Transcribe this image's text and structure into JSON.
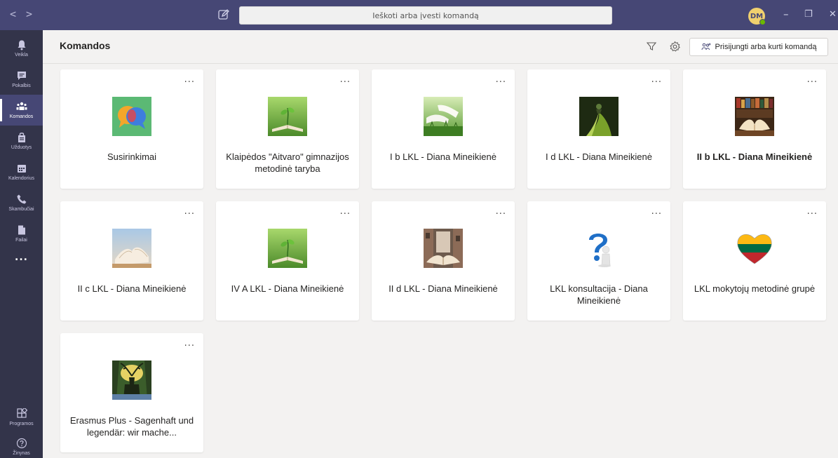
{
  "titlebar": {
    "back": "<",
    "forward": ">",
    "search_placeholder": "Ieškoti arba įvesti komandą",
    "avatar_initials": "DM",
    "minimize": "–",
    "maximize": "❐",
    "close": "✕"
  },
  "rail": {
    "items": [
      {
        "label": "Veikla",
        "icon": "bell-icon"
      },
      {
        "label": "Pokalbis",
        "icon": "chat-icon"
      },
      {
        "label": "Komandos",
        "icon": "teams-icon",
        "active": true
      },
      {
        "label": "Užduotys",
        "icon": "assignments-icon"
      },
      {
        "label": "Kalendorius",
        "icon": "calendar-icon"
      },
      {
        "label": "Skambučiai",
        "icon": "phone-icon"
      },
      {
        "label": "Failai",
        "icon": "file-icon"
      }
    ],
    "more": "...",
    "apps_label": "Programos",
    "help_label": "Žinynas"
  },
  "header": {
    "title": "Komandos",
    "join_button": "Prisijungti arba kurti komandą"
  },
  "cards": [
    {
      "name": "Susirinkimai",
      "more": "...",
      "image": "chat-bubbles",
      "bold": false
    },
    {
      "name": "Klaipėdos \"Aitvaro\" gimnazijos metodinė taryba",
      "more": "...",
      "image": "book-sprout",
      "bold": false
    },
    {
      "name": "I b LKL - Diana Mineikienė",
      "more": "...",
      "image": "book-grass",
      "bold": false
    },
    {
      "name": "I d LKL - Diana Mineikienė",
      "more": "...",
      "image": "book-dark",
      "bold": false
    },
    {
      "name": "II b LKL - Diana Mineikienė",
      "more": "...",
      "image": "book-library",
      "bold": true
    },
    {
      "name": "II c LKL - Diana Mineikienė",
      "more": "...",
      "image": "book-open-sky",
      "bold": false
    },
    {
      "name": "IV A LKL - Diana Mineikienė",
      "more": "...",
      "image": "book-sprout",
      "bold": false
    },
    {
      "name": "II d LKL - Diana Mineikienė",
      "more": "...",
      "image": "book-street",
      "bold": false
    },
    {
      "name": "LKL konsultacija - Diana Mineikienė",
      "more": "...",
      "image": "question-figure",
      "bold": false
    },
    {
      "name": "LKL mokytojų metodinė grupė",
      "more": "...",
      "image": "lithuania-heart",
      "bold": false
    },
    {
      "name": "Erasmus Plus - Sagenhaft und legendär: wir mache...",
      "more": "...",
      "image": "deer-forest",
      "bold": false
    }
  ],
  "colors": {
    "titlebar": "#464775",
    "rail": "#33344a",
    "background": "#f3f2f1",
    "card": "#ffffff"
  }
}
